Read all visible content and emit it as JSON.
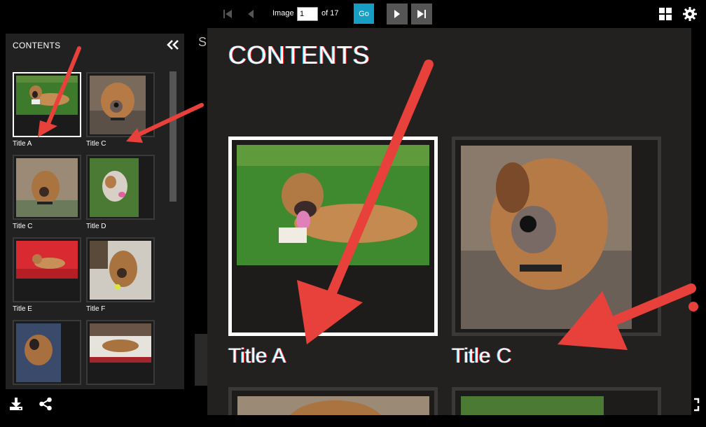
{
  "toolbar": {
    "image_label": "Image",
    "page_value": "1",
    "of_label": "of 17",
    "go_label": "Go"
  },
  "sidebar": {
    "title": "CONTENTS",
    "thumbnails": [
      {
        "label": "Title A",
        "selected": true
      },
      {
        "label": "Title C",
        "selected": false
      },
      {
        "label": "Title C",
        "selected": false
      },
      {
        "label": "Title D",
        "selected": false
      },
      {
        "label": "Title E",
        "selected": false
      },
      {
        "label": "Title F",
        "selected": false
      },
      {
        "label": "",
        "selected": false
      },
      {
        "label": "",
        "selected": false
      }
    ]
  },
  "main": {
    "edge_text": "S"
  },
  "zoom": {
    "title": "CONTENTS",
    "items": [
      {
        "label": "Title A",
        "selected": true
      },
      {
        "label": "Title C",
        "selected": false
      }
    ]
  },
  "colors": {
    "accent": "#169ec4",
    "annotation_arrow": "#e8403a",
    "panel_bg": "#212121",
    "selected_border": "#ffffff"
  }
}
